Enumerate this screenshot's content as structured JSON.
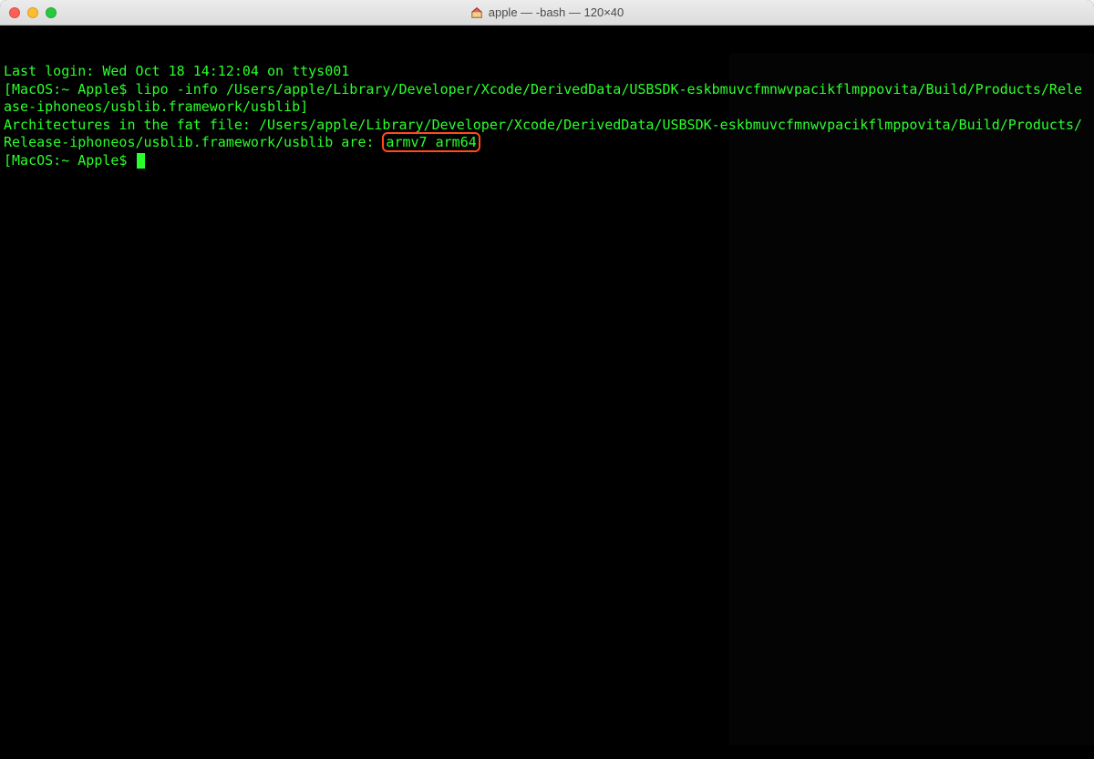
{
  "window": {
    "title": "apple — -bash — 120×40"
  },
  "terminal": {
    "last_login": "Last login: Wed Oct 18 14:12:04 on ttys001",
    "prompt_open": "[",
    "prompt_close": "]",
    "prompt1": "MacOS:~ Apple$ ",
    "cmd1": "lipo -info /Users/apple/Library/Developer/Xcode/DerivedData/USBSDK-eskbmuvcfmnwvpacikflmppovita/Build/Products/Release-iphoneos/usblib.framework/usblib",
    "out_prefix": "Architectures in the fat file: /Users/apple/Library/Developer/Xcode/DerivedData/USBSDK-eskbmuvcfmnwvpacikflmppovita/Build/Products/Release-iphoneos/usblib.framework/usblib are: ",
    "out_highlight": "armv7 arm64",
    "prompt2": "MacOS:~ Apple$ "
  },
  "colors": {
    "terminal_fg": "#2bff2b",
    "terminal_bg": "#000000",
    "highlight_border": "#ff4a1c"
  }
}
